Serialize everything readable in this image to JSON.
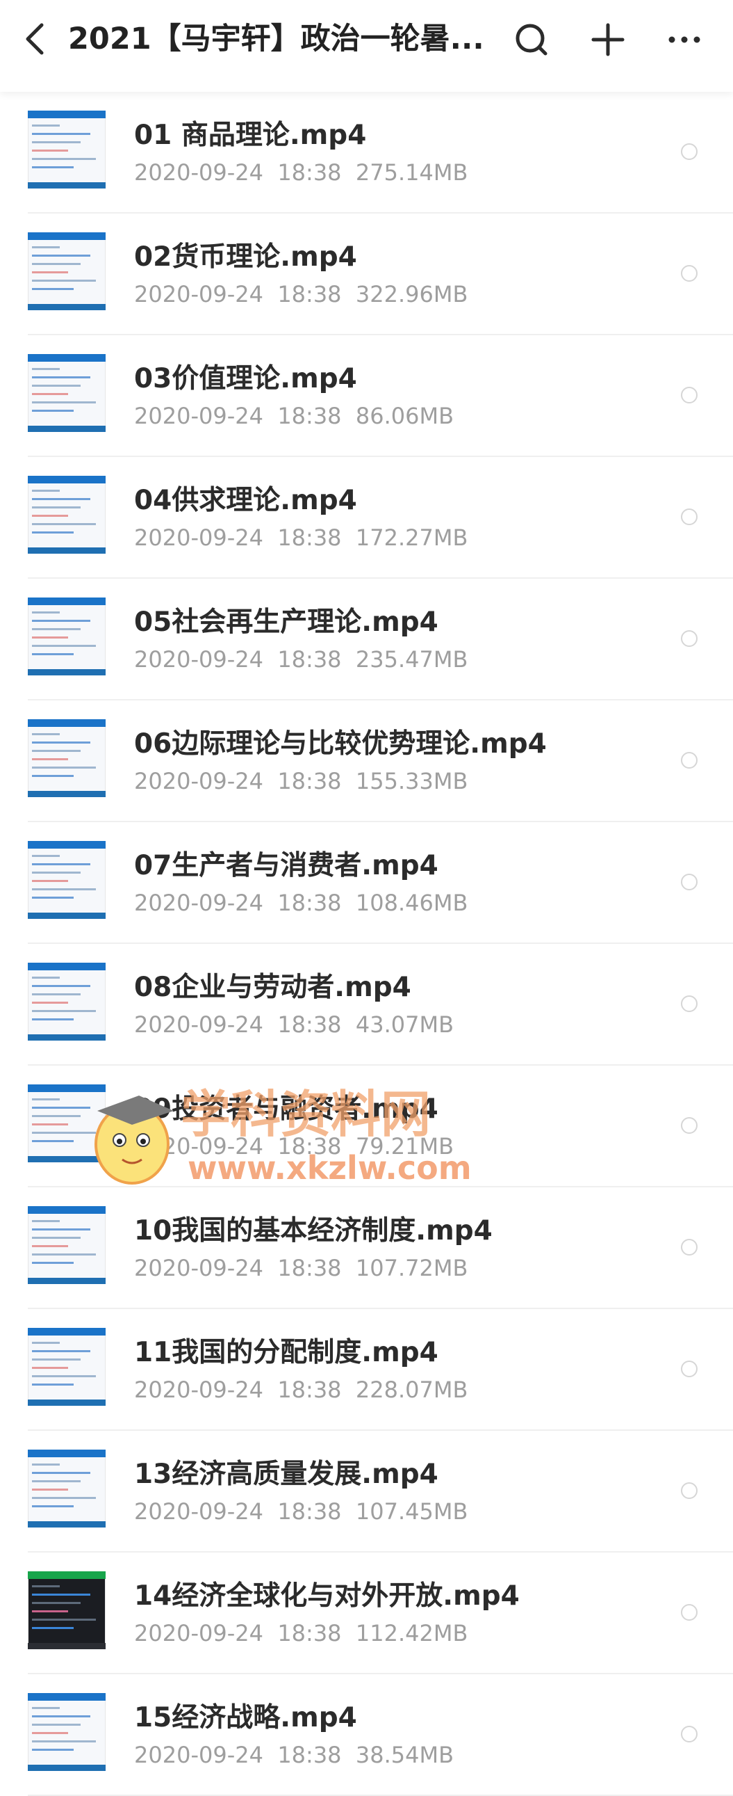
{
  "header": {
    "title": "2021【马宇轩】政治一轮暑...",
    "back_icon": "chevron-left-icon",
    "search_icon": "search-icon",
    "add_icon": "plus-icon",
    "more_icon": "more-horizontal-icon"
  },
  "files": [
    {
      "name": "01 商品理论.mp4",
      "date": "2020-09-24",
      "time": "18:38",
      "size": "275.14MB",
      "meta": "2020-09-24  18:38  275.14MB",
      "thumb": "light"
    },
    {
      "name": "02货币理论.mp4",
      "date": "2020-09-24",
      "time": "18:38",
      "size": "322.96MB",
      "meta": "2020-09-24  18:38  322.96MB",
      "thumb": "light"
    },
    {
      "name": "03价值理论.mp4",
      "date": "2020-09-24",
      "time": "18:38",
      "size": "86.06MB",
      "meta": "2020-09-24  18:38  86.06MB",
      "thumb": "light"
    },
    {
      "name": "04供求理论.mp4",
      "date": "2020-09-24",
      "time": "18:38",
      "size": "172.27MB",
      "meta": "2020-09-24  18:38  172.27MB",
      "thumb": "light"
    },
    {
      "name": "05社会再生产理论.mp4",
      "date": "2020-09-24",
      "time": "18:38",
      "size": "235.47MB",
      "meta": "2020-09-24  18:38  235.47MB",
      "thumb": "light"
    },
    {
      "name": "06边际理论与比较优势理论.mp4",
      "date": "2020-09-24",
      "time": "18:38",
      "size": "155.33MB",
      "meta": "2020-09-24  18:38  155.33MB",
      "thumb": "light"
    },
    {
      "name": "07生产者与消费者.mp4",
      "date": "2020-09-24",
      "time": "18:38",
      "size": "108.46MB",
      "meta": "2020-09-24  18:38  108.46MB",
      "thumb": "light"
    },
    {
      "name": "08企业与劳动者.mp4",
      "date": "2020-09-24",
      "time": "18:38",
      "size": "43.07MB",
      "meta": "2020-09-24  18:38  43.07MB",
      "thumb": "light"
    },
    {
      "name": "09投资者与融资者.mp4",
      "date": "2020-09-24",
      "time": "18:38",
      "size": "79.21MB",
      "meta": "2020-09-24  18:38  79.21MB",
      "thumb": "light"
    },
    {
      "name": "10我国的基本经济制度.mp4",
      "date": "2020-09-24",
      "time": "18:38",
      "size": "107.72MB",
      "meta": "2020-09-24  18:38  107.72MB",
      "thumb": "light"
    },
    {
      "name": "11我国的分配制度.mp4",
      "date": "2020-09-24",
      "time": "18:38",
      "size": "228.07MB",
      "meta": "2020-09-24  18:38  228.07MB",
      "thumb": "light"
    },
    {
      "name": "13经济高质量发展.mp4",
      "date": "2020-09-24",
      "time": "18:38",
      "size": "107.45MB",
      "meta": "2020-09-24  18:38  107.45MB",
      "thumb": "light"
    },
    {
      "name": "14经济全球化与对外开放.mp4",
      "date": "2020-09-24",
      "time": "18:38",
      "size": "112.42MB",
      "meta": "2020-09-24  18:38  112.42MB",
      "thumb": "dark"
    },
    {
      "name": "15经济战略.mp4",
      "date": "2020-09-24",
      "time": "18:38",
      "size": "38.54MB",
      "meta": "2020-09-24  18:38  38.54MB",
      "thumb": "light"
    }
  ],
  "watermark": {
    "text_cn": "学科资料网",
    "text_url": "www.xkzlw.com",
    "colors": {
      "primary": "#f0a06a",
      "secondary": "#f6c99a"
    }
  },
  "colors": {
    "title": "#222222",
    "filename": "#2b2b2b",
    "meta": "#9e9e9e",
    "thumb_accent": "#1a73c8",
    "divider": "#efefef"
  }
}
